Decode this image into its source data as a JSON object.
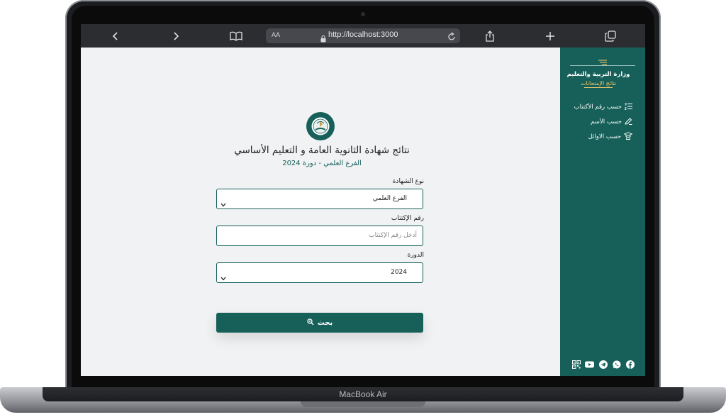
{
  "browser": {
    "text_size_label": "AA",
    "url": "http://localhost:3000"
  },
  "sidebar": {
    "ministry": "وزارة التربية والتعليم",
    "subtitle": "نتائج الإمتحانات",
    "items": [
      {
        "label": "حسب رقم الأكتتاب",
        "icon": "list-numbered-icon"
      },
      {
        "label": "حسب الأسم",
        "icon": "pencil-icon"
      },
      {
        "label": "حسب الاوائل",
        "icon": "graduation-cap-icon"
      }
    ],
    "socials": [
      "facebook-icon",
      "whatsapp-icon",
      "telegram-icon",
      "youtube-icon",
      "qr-code-icon"
    ]
  },
  "main": {
    "title": "نتائج شهادة الثانوية العامة و التعليم الأساسي",
    "subtitle": "الفرع العلمي - دورة 2024",
    "certificate": {
      "label": "نوع الشهادة",
      "value": "الفرع العلمي"
    },
    "seat_number": {
      "label": "رقم الإكتتاب",
      "placeholder": "أدخل رقم الإكتتاب"
    },
    "session": {
      "label": "الدورة",
      "value": "2024"
    },
    "search_label": "بحث"
  },
  "device": {
    "brand": "MacBook Air"
  },
  "colors": {
    "primary": "#17605a",
    "accent": "#f0c869",
    "background": "#f1f2f3"
  }
}
